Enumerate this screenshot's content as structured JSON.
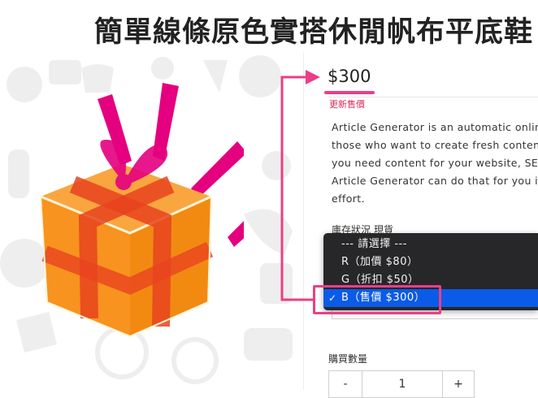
{
  "product": {
    "title": "簡單線條原色實搭休閒帆布平底鞋",
    "price": "$300",
    "price_note": "更新售價",
    "description_lines": [
      "Article Generator is an automatic online t",
      "those who want to create fresh content f",
      "you need content for your website, SEO",
      "Article Generator can do that for you in f",
      "effort."
    ]
  },
  "stock": {
    "label": "庫存狀況",
    "value": "現貨"
  },
  "variant_dropdown": {
    "options": [
      {
        "label": "--- 請選擇 ---",
        "selected": false
      },
      {
        "label": "R（加價 $80）",
        "selected": false
      },
      {
        "label": "G（折扣 $50）",
        "selected": false
      },
      {
        "label": "B（售價 $300）",
        "selected": true
      }
    ],
    "check_glyph": "✓"
  },
  "quantity": {
    "label": "購買數量",
    "minus_label": "-",
    "value": "1",
    "plus_label": "+"
  },
  "colors": {
    "accent": "#ea3f86",
    "dropdown_bg": "#27272a",
    "selected_bg": "#0a5be8",
    "gift_orange": "#f7931e",
    "ribbon": "#e4007f"
  },
  "icons": [
    "gift-box-illustration",
    "callout-arrow"
  ]
}
